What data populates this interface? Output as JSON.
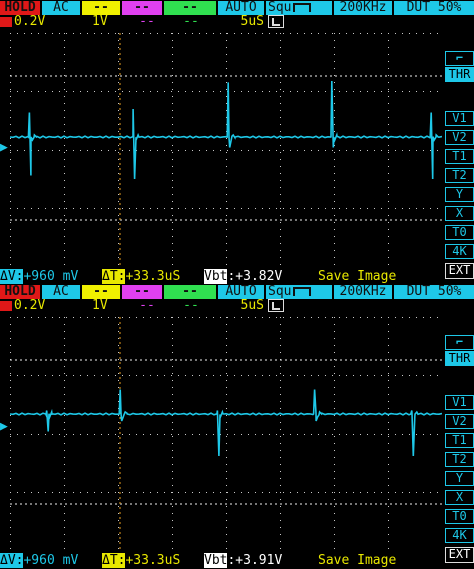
{
  "screens": [
    {
      "hold": "HOLD",
      "coupling": "AC",
      "ch_yellow": "--",
      "ch_magenta": "--",
      "ch_green": "--",
      "trigger_mode": "AUTO",
      "waveform": "Squ",
      "frequency": "200KHz",
      "duty": "DUT 50%",
      "volt_div": "0.2V",
      "volt_div_2": "1V",
      "dash_magenta": "--",
      "dash_green": "--",
      "time_div": "5uS",
      "side_buttons": [
        "THR",
        "V1",
        "V2",
        "T1",
        "T2",
        "Y",
        "X",
        "T0",
        "4K",
        "EXT"
      ],
      "status": {
        "voltage_label": "ΔV:",
        "voltage_value": "+960 mV",
        "time_label": "ΔT:",
        "time_value": "+33.3uS",
        "vbt_label": "Vbt",
        "vbt_value": ":+3.82V",
        "save": "Save Image"
      },
      "spikes": [
        {
          "t": 0.045,
          "up": 0.35,
          "down": -0.55
        },
        {
          "t": 0.285,
          "up": 0.4,
          "down": -0.6
        },
        {
          "t": 0.505,
          "up": 0.78,
          "down": -0.15
        },
        {
          "t": 0.745,
          "up": 0.8,
          "down": -0.15
        },
        {
          "t": 0.975,
          "up": 0.35,
          "down": -0.6
        }
      ]
    },
    {
      "hold": "HOLD",
      "coupling": "AC",
      "ch_yellow": "--",
      "ch_magenta": "--",
      "ch_green": "--",
      "trigger_mode": "AUTO",
      "waveform": "Squ",
      "frequency": "200KHz",
      "duty": "DUT 50%",
      "volt_div": "0.2V",
      "volt_div_2": "1V",
      "dash_magenta": "--",
      "dash_green": "--",
      "time_div": "5uS",
      "side_buttons": [
        "THR",
        "V1",
        "V2",
        "T1",
        "T2",
        "Y",
        "X",
        "T0",
        "4K",
        "EXT"
      ],
      "status": {
        "voltage_label": "ΔV:",
        "voltage_value": "+960 mV",
        "time_label": "ΔT:",
        "time_value": "+33.3uS",
        "vbt_label": "Vbt",
        "vbt_value": ":+3.91V",
        "save": "Save Image"
      },
      "spikes": [
        {
          "t": 0.085,
          "up": 0.05,
          "down": -0.25
        },
        {
          "t": 0.255,
          "up": 0.35,
          "down": -0.1
        },
        {
          "t": 0.48,
          "up": 0.05,
          "down": -0.6
        },
        {
          "t": 0.705,
          "up": 0.35,
          "down": -0.1
        },
        {
          "t": 0.93,
          "up": 0.05,
          "down": -0.6
        }
      ]
    }
  ],
  "colors": {
    "trace": "#1ec8e8",
    "grid": "#c8c8c8",
    "cursor": "#e8a020"
  }
}
